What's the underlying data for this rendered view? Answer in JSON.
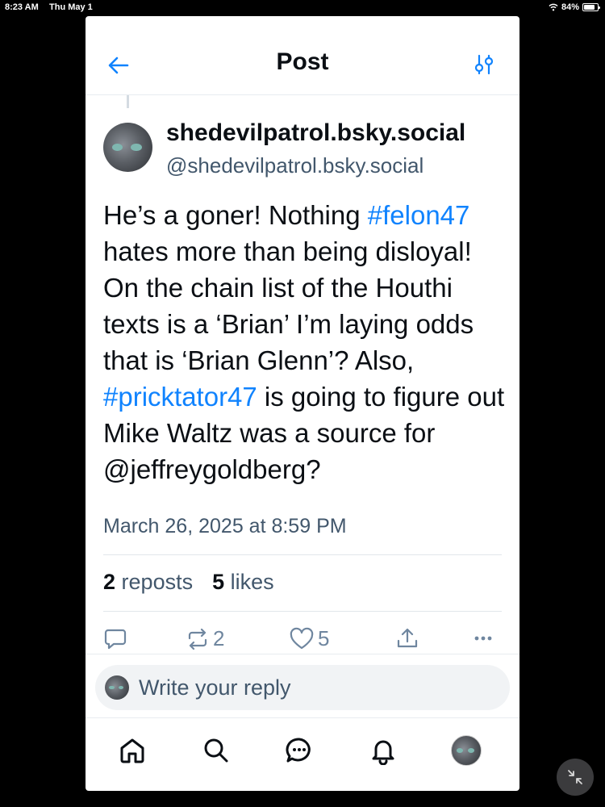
{
  "status_bar": {
    "time": "8:23 AM",
    "date": "Thu May 1",
    "battery": "84%",
    "battery_level": 0.84
  },
  "header": {
    "title": "Post",
    "back_icon": "arrow-left-icon",
    "filter_icon": "sliders-icon"
  },
  "post": {
    "author_name": "shedevilpatrol.bsky.social",
    "author_handle": "@shedevilpatrol.bsky.social",
    "text_segments": [
      {
        "text": "He’s a goner! Nothing ",
        "tag": false
      },
      {
        "text": "#felon47",
        "tag": true
      },
      {
        "text": " hates more than being disloyal! On the chain list of the Houthi texts is a ‘Brian’ I’m laying odds that is ‘Brian Glenn’? Also, ",
        "tag": false
      },
      {
        "text": "#pricktator47",
        "tag": true
      },
      {
        "text": " is going to figure out Mike Waltz was a source for @jeffreygoldberg?",
        "tag": false
      }
    ],
    "timestamp": "March 26, 2025 at 8:59 PM",
    "reposts_count": "2",
    "reposts_label": "reposts",
    "likes_count": "5",
    "likes_label": "likes"
  },
  "actions": {
    "reply_icon": "speech-bubble-icon",
    "repost_icon": "repost-icon",
    "repost_count": "2",
    "like_icon": "heart-icon",
    "like_count": "5",
    "share_icon": "share-icon",
    "more_icon": "ellipsis-icon"
  },
  "reply": {
    "placeholder": "Write your reply"
  },
  "tabbar": {
    "items": [
      "home-icon",
      "search-icon",
      "chat-icon",
      "bell-icon",
      "profile-avatar"
    ]
  },
  "colors": {
    "accent": "#1083fe",
    "muted": "#42576c",
    "icon": "#6f869f"
  }
}
